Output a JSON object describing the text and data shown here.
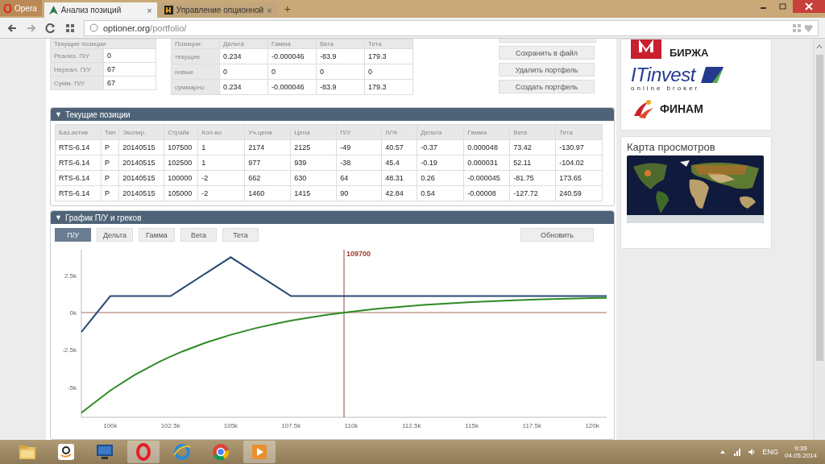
{
  "browser": {
    "menu_button": "Opera",
    "tabs": [
      {
        "title": "Анализ позиций",
        "selected": true,
        "close": "×"
      },
      {
        "title": "Управление опционной",
        "selected": false,
        "close": "×"
      }
    ],
    "new_tab": "+",
    "address": {
      "host": "optioner.org",
      "path": "/portfolio/"
    }
  },
  "pl_summary": {
    "title": "Текущие позиции",
    "rows": [
      {
        "label": "Реализ. П/У",
        "value": "0"
      },
      {
        "label": "Нереал. П/У",
        "value": "67"
      },
      {
        "label": "Сумм. П/У",
        "value": "67"
      }
    ]
  },
  "greeks_summary": {
    "columns": [
      "Позиции:",
      "Дельта",
      "Гамма",
      "Вега",
      "Тета"
    ],
    "rows": [
      [
        "текущие",
        "0.234",
        "-0.000046",
        "-83.9",
        "179.3"
      ],
      [
        "новые",
        "0",
        "0",
        "0",
        "0"
      ],
      [
        "суммарно",
        "0.234",
        "-0.000046",
        "-83.9",
        "179.3"
      ]
    ]
  },
  "actions": [
    "Сохранить в файл",
    "Удалить портфель",
    "Создать портфель"
  ],
  "positions": {
    "toggle": "▼",
    "title": "Текущие позиции",
    "columns": [
      "Баз.актив",
      "Тип",
      "Экспир.",
      "Страйк",
      "Кол-во",
      "Уч.цена",
      "Цена",
      "П/У",
      "IV%",
      "Дельта",
      "Гамма",
      "Вега",
      "Тета"
    ],
    "rows": [
      [
        "RTS-6.14",
        "P",
        "20140515",
        "107500",
        "1",
        "2174",
        "2125",
        "-49",
        "40.57",
        "-0.37",
        "0.000048",
        "73.42",
        "-130.97"
      ],
      [
        "RTS-6.14",
        "P",
        "20140515",
        "102500",
        "1",
        "977",
        "939",
        "-38",
        "45.4",
        "-0.19",
        "0.000031",
        "52.11",
        "-104.02"
      ],
      [
        "RTS-6.14",
        "P",
        "20140515",
        "100000",
        "-2",
        "662",
        "630",
        "64",
        "48.31",
        "0.26",
        "-0.000045",
        "-81.75",
        "173.65"
      ],
      [
        "RTS-6.14",
        "P",
        "20140515",
        "105000",
        "-2",
        "1460",
        "1415",
        "90",
        "42.84",
        "0.54",
        "-0.00008",
        "-127.72",
        "240.59"
      ]
    ]
  },
  "chart_panel": {
    "toggle": "▼",
    "title": "График П/У и греков",
    "modes": [
      {
        "label": "П/У",
        "selected": true
      },
      {
        "label": "Дельта",
        "selected": false
      },
      {
        "label": "Гамма",
        "selected": false
      },
      {
        "label": "Вега",
        "selected": false
      },
      {
        "label": "Тета",
        "selected": false
      }
    ],
    "refresh": "Обновить",
    "chart_data": {
      "type": "line",
      "x": [
        98800,
        100000,
        101000,
        102000,
        102500,
        103000,
        104000,
        105000,
        106000,
        107000,
        107500,
        108000,
        109000,
        110000,
        111000,
        112000,
        113000,
        114000,
        115000,
        116000,
        117000,
        118000,
        119000,
        120000,
        120600
      ],
      "series": [
        {
          "color": "#294a72",
          "values": [
            -1300,
            1100,
            1100,
            1100,
            1100,
            1620,
            2660,
            3700,
            2660,
            1620,
            1100,
            1100,
            1100,
            1100,
            1100,
            1100,
            1100,
            1100,
            1100,
            1100,
            1100,
            1100,
            1100,
            1100,
            1100
          ]
        },
        {
          "color": "#2f8a24",
          "values": [
            -6700,
            -5205,
            -4178,
            -3317,
            -2940,
            -2595,
            -1991,
            -1484,
            -1058,
            -701,
            -545,
            -402,
            -152,
            59,
            235,
            383,
            507,
            611,
            698,
            771,
            832,
            883,
            926,
            962,
            981
          ]
        }
      ],
      "xlim": [
        98800,
        120600
      ],
      "ylim": [
        -7000,
        4200
      ],
      "xticks": [
        {
          "value": 100000,
          "label": "100k"
        },
        {
          "value": 102500,
          "label": "102.5k"
        },
        {
          "value": 105000,
          "label": "105k"
        },
        {
          "value": 107500,
          "label": "107.5k"
        },
        {
          "value": 110000,
          "label": "110k"
        },
        {
          "value": 112500,
          "label": "112.5k"
        },
        {
          "value": 115000,
          "label": "115k"
        },
        {
          "value": 117500,
          "label": "117.5k"
        },
        {
          "value": 120000,
          "label": "120k"
        }
      ],
      "yticks": [
        {
          "value": -5000,
          "label": "-5k"
        },
        {
          "value": -2500,
          "label": "-2.5k"
        },
        {
          "value": 0,
          "label": "0k"
        },
        {
          "value": 2500,
          "label": "2.5k"
        }
      ],
      "ref_lines": [
        {
          "axis": "y",
          "value": 0
        },
        {
          "axis": "x",
          "value": 109700,
          "label": "109700"
        }
      ]
    }
  },
  "sidebar": {
    "sponsors": [
      {
        "kind": "moex",
        "text": "БИРЖА"
      },
      {
        "kind": "itinvest",
        "text": "ITinvest",
        "tagline": "online broker"
      },
      {
        "kind": "finam",
        "text": "ФИНАМ"
      }
    ],
    "map": {
      "title": "Карта просмотров"
    }
  },
  "taskbar": {
    "language": "ENG",
    "time": "9:39",
    "date": "04.05.2014"
  }
}
